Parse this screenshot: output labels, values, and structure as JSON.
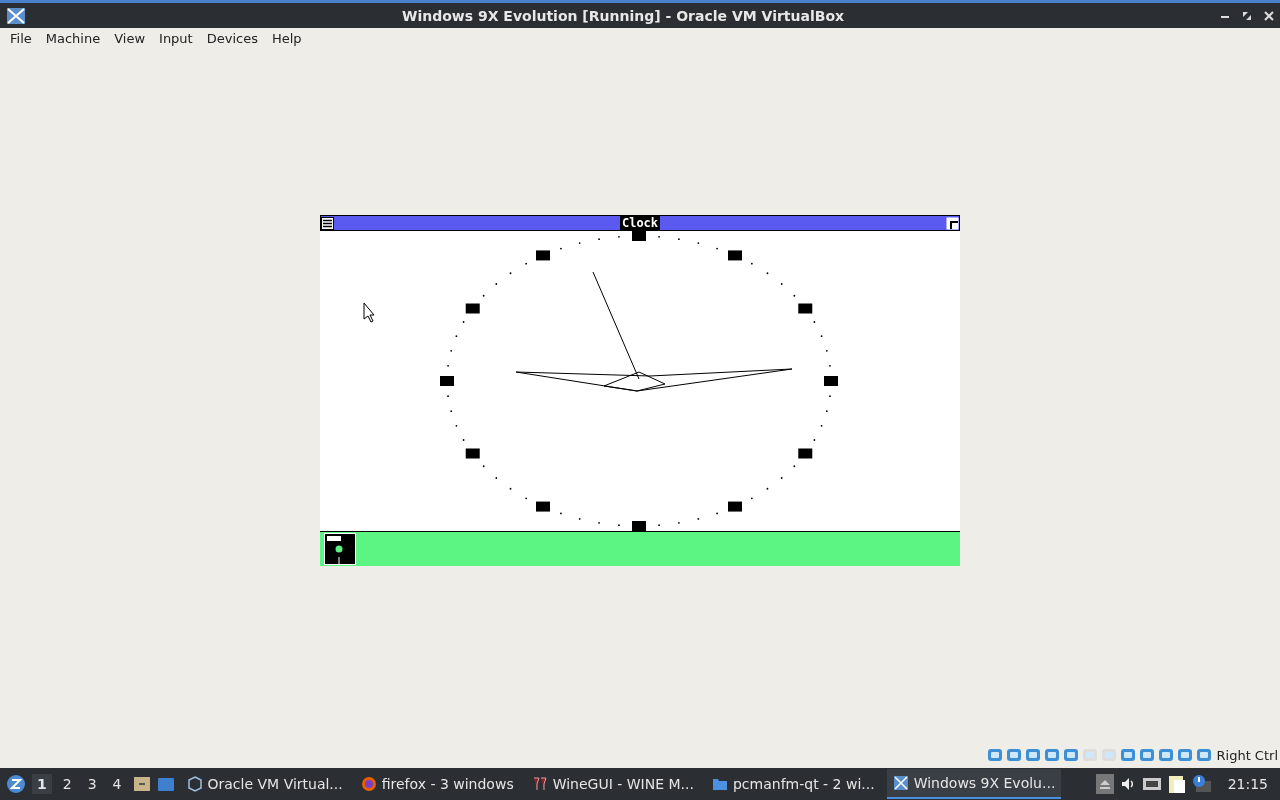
{
  "window": {
    "title": "Windows 9X Evolution [Running] - Oracle VM VirtualBox"
  },
  "menu": [
    "File",
    "Machine",
    "View",
    "Input",
    "Devices",
    "Help"
  ],
  "guest_window": {
    "title": "Clock"
  },
  "status_bar": {
    "host_key": "Right Ctrl"
  },
  "taskbar": {
    "workspaces": [
      {
        "label": "1",
        "selected": true
      },
      {
        "label": "2",
        "selected": false
      },
      {
        "label": "3",
        "selected": false
      },
      {
        "label": "4",
        "selected": false
      }
    ],
    "tasks": [
      {
        "label": "Oracle VM Virtual...",
        "kind": "vbox",
        "selected": false
      },
      {
        "label": "firefox - 3 windows",
        "kind": "firefox",
        "selected": false
      },
      {
        "label": "WineGUI - WINE M...",
        "kind": "wine",
        "selected": false
      },
      {
        "label": "pcmanfm-qt - 2 wi...",
        "kind": "folder",
        "selected": false
      },
      {
        "label": "Windows 9X Evolu...",
        "kind": "vm",
        "selected": true
      }
    ],
    "clock": "21:15"
  }
}
